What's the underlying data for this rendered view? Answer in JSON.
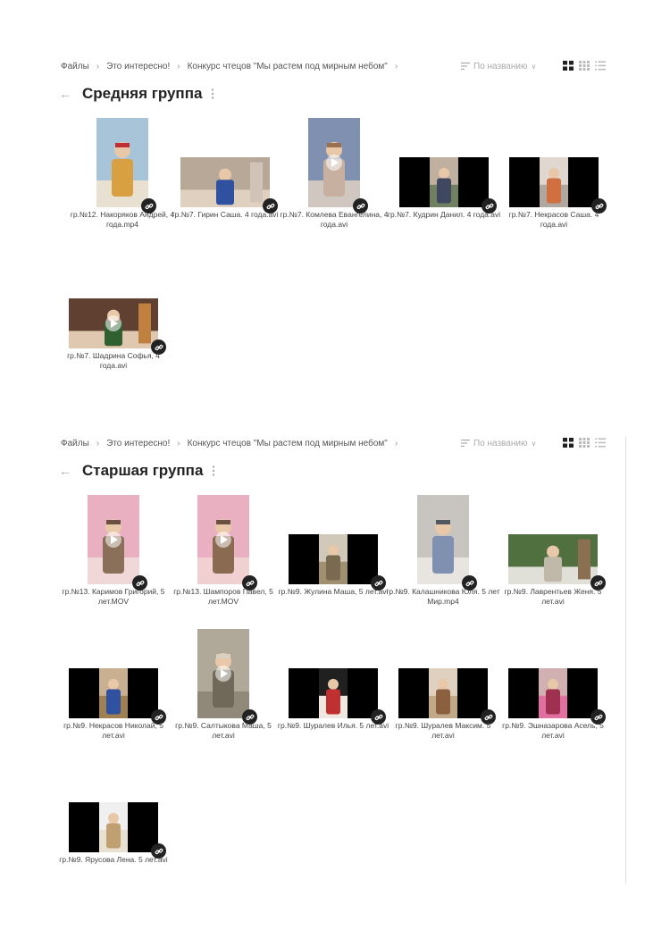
{
  "sections": [
    {
      "breadcrumb": [
        "Файлы",
        "Это интересно!",
        "Конкурс чтецов \"Мы растем под мирным небом\""
      ],
      "sort_label": "По названию",
      "title": "Средняя группа",
      "files": [
        {
          "name": "гр.№12. Накоряков Андрей, 4 года.mp4",
          "palette": [
            "#a8c4d8",
            "#d8a040",
            "#c03030",
            "#e8e0d0"
          ]
        },
        {
          "name": "гр.№7. Гирин Саша. 4 года.avi",
          "palette": [
            "#b8a898",
            "#d0c4b8",
            "#3050a0",
            "#e0d0c0"
          ]
        },
        {
          "name": "гр.№7. Комлева Евангелина, 4 года.avi",
          "palette": [
            "#8090b0",
            "#c8b0a0",
            "#9a7050",
            "#d0c8c0"
          ]
        },
        {
          "name": "гр.№7. Кудрин Данил. 4 года.avi",
          "palette": [
            "#000000",
            "#708060",
            "#404860",
            "#c0b0a0"
          ]
        },
        {
          "name": "гр.№7. Некрасов Саша. 4 года.avi",
          "palette": [
            "#000000",
            "#b0a8a0",
            "#d07040",
            "#e0d8d0"
          ]
        },
        {
          "name": "гр.№7. Шадрина Софья, 4 года.avi",
          "palette": [
            "#604030",
            "#c08040",
            "#306030",
            "#e0c8b0"
          ]
        }
      ]
    },
    {
      "breadcrumb": [
        "Файлы",
        "Это интересно!",
        "Конкурс чтецов \"Мы растем под мирным небом\""
      ],
      "sort_label": "По названию",
      "title": "Старшая группа",
      "files": [
        {
          "name": "гр.№13. Каримов Григорий, 5 лет.MOV",
          "palette": [
            "#e8b0c0",
            "#8a7058",
            "#6a5040",
            "#f0d8d8"
          ]
        },
        {
          "name": "гр.№13. Шампоров Павел, 5 лет.MOV",
          "palette": [
            "#e8b0c0",
            "#8a6a50",
            "#6a5040",
            "#f0d0d0"
          ]
        },
        {
          "name": "гр.№9. Жулина Маша, 5 лет.avi",
          "palette": [
            "#000000",
            "#a09070",
            "#7a6a50",
            "#d0c8b8"
          ]
        },
        {
          "name": "гр.№9. Калашникова Юля. 5 лет Мир.mp4",
          "palette": [
            "#c8c4c0",
            "#8090b0",
            "#505860",
            "#e8e4e0"
          ]
        },
        {
          "name": "гр.№9. Лаврентьев Женя. 5 лет.avi",
          "palette": [
            "#507040",
            "#8a7050",
            "#c0b8a8",
            "#e0e0d8"
          ]
        },
        {
          "name": "гр.№9. Некрасов Николай, 5 лет.avi",
          "palette": [
            "#000000",
            "#a08050",
            "#3050a0",
            "#c8b090"
          ]
        },
        {
          "name": "гр.№9. Салтыкова Маша, 5 лет.avi",
          "palette": [
            "#b0a898",
            "#706858",
            "#d8d0c0",
            "#908878"
          ]
        },
        {
          "name": "гр.№9. Шуралев Илья. 5 лет.avi",
          "palette": [
            "#000000",
            "#f0e8e0",
            "#c03030",
            "#202020"
          ]
        },
        {
          "name": "гр.№9. Шуралев Максим. 5 лет.avi",
          "palette": [
            "#000000",
            "#c0a888",
            "#8a6040",
            "#e0d0c0"
          ]
        },
        {
          "name": "гр.№9. Эшназарова Асель, 5 лет.avi",
          "palette": [
            "#000000",
            "#e070a0",
            "#a03050",
            "#d0b0b0"
          ]
        },
        {
          "name": "гр.№9. Ярусова Лена. 5 лет.avi",
          "palette": [
            "#000000",
            "#e8e0d0",
            "#c0a070",
            "#f0f0f0"
          ]
        }
      ]
    }
  ]
}
